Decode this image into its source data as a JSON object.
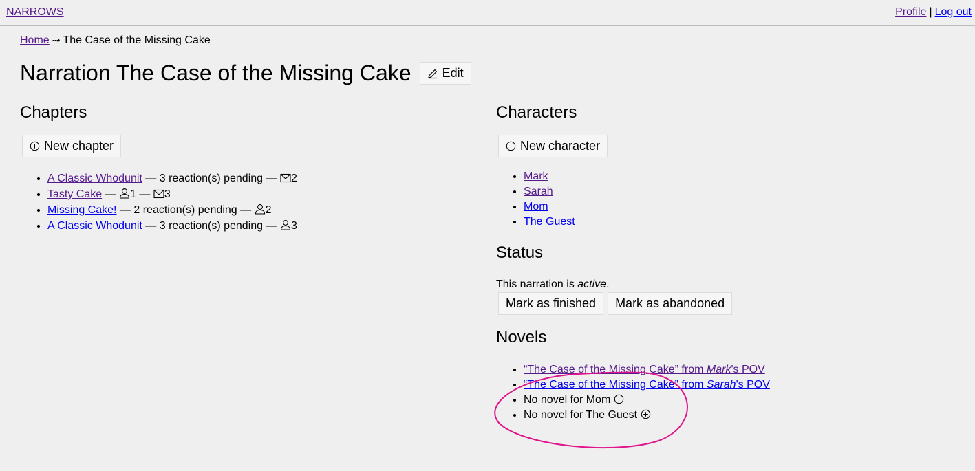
{
  "topbar": {
    "brand": "NARROWS",
    "profile_link": "Profile",
    "separator": "|",
    "logout_link": "Log out"
  },
  "breadcrumb": {
    "home": "Home",
    "arrow": "⇢",
    "current": "The Case of the Missing Cake"
  },
  "page": {
    "title": "Narration The Case of the Missing Cake",
    "edit_label": "Edit"
  },
  "chapters": {
    "heading": "Chapters",
    "new_label": "New chapter",
    "items": [
      {
        "title": "A Classic Whodunit",
        "visited": true,
        "pending": " — 3 reaction(s) pending — ",
        "badges": [
          {
            "type": "envelope",
            "count": "2"
          }
        ]
      },
      {
        "title": "Tasty Cake",
        "visited": true,
        "pending": " — ",
        "badges": [
          {
            "type": "person",
            "count": "1"
          },
          {
            "type": "envelope",
            "count": "3"
          }
        ]
      },
      {
        "title": "Missing Cake!",
        "visited": false,
        "pending": " — 2 reaction(s) pending — ",
        "badges": [
          {
            "type": "person",
            "count": "2"
          }
        ]
      },
      {
        "title": "A Classic Whodunit",
        "visited": false,
        "pending": " — 3 reaction(s) pending — ",
        "badges": [
          {
            "type": "person",
            "count": "3"
          }
        ]
      }
    ]
  },
  "characters": {
    "heading": "Characters",
    "new_label": "New character",
    "items": [
      {
        "name": "Mark",
        "visited": true
      },
      {
        "name": "Sarah",
        "visited": true
      },
      {
        "name": "Mom",
        "visited": false
      },
      {
        "name": "The Guest",
        "visited": false
      }
    ]
  },
  "status": {
    "heading": "Status",
    "text_prefix": "This narration is ",
    "state": "active",
    "text_suffix": ".",
    "finish_label": "Mark as finished",
    "abandon_label": "Mark as abandoned"
  },
  "novels": {
    "heading": "Novels",
    "items": [
      {
        "kind": "link",
        "visited": true,
        "quote_title": "“The Case of the Missing Cake”",
        "from": " from ",
        "character": "Mark",
        "suffix": "'s POV"
      },
      {
        "kind": "link",
        "visited": false,
        "quote_title": "“The Case of the Missing Cake”",
        "from": " from ",
        "character": "Sarah",
        "suffix": "'s POV"
      },
      {
        "kind": "missing",
        "text": "No novel for Mom"
      },
      {
        "kind": "missing",
        "text": "No novel for The Guest"
      }
    ]
  },
  "colors": {
    "background": "#efefef",
    "link": "#0000ee",
    "visited_link": "#551a8b",
    "annotation": "#e0148c"
  },
  "icons": {
    "edit": "pencil-icon",
    "add": "plus-circle-icon",
    "envelope": "envelope-icon",
    "person": "person-icon"
  }
}
